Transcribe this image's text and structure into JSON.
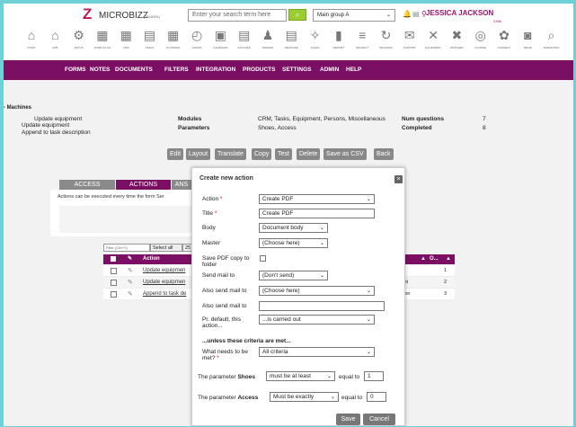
{
  "header": {
    "brand": "MICROBIZZ",
    "version": "(3010921)",
    "search_placeholder": "Enter your search term here",
    "group_select": "Main group A",
    "user_name": "JESSICA JACKSON",
    "user_id": "2396",
    "brand_color": "#7a0f63",
    "toolbar": [
      {
        "label": "Start",
        "icon": "house-icon"
      },
      {
        "label": "ADB",
        "icon": "bank-icon"
      },
      {
        "label": "Setup",
        "icon": "gear-icon"
      },
      {
        "label": "Work Plan",
        "icon": "grid-icon"
      },
      {
        "label": "CRM",
        "icon": "table-icon"
      },
      {
        "label": "Tasks",
        "icon": "list-icon"
      },
      {
        "label": "Planning",
        "icon": "planning-icon"
      },
      {
        "label": "Hours",
        "icon": "clock-icon"
      },
      {
        "label": "Calendar",
        "icon": "calendar-icon"
      },
      {
        "label": "Invoices",
        "icon": "invoice-icon"
      },
      {
        "label": "Person",
        "icon": "person-icon"
      },
      {
        "label": "Register",
        "icon": "register-icon"
      },
      {
        "label": "Sales",
        "icon": "sales-icon"
      },
      {
        "label": "Report",
        "icon": "chart-icon"
      },
      {
        "label": "Project",
        "icon": "project-icon"
      },
      {
        "label": "Process",
        "icon": "process-icon"
      },
      {
        "label": "Support",
        "icon": "support-icon"
      },
      {
        "label": "Equipment",
        "icon": "tools-icon"
      },
      {
        "label": "Intranet",
        "icon": "close-icon"
      },
      {
        "label": "Course",
        "icon": "course-icon"
      },
      {
        "label": "Connect",
        "icon": "connect-icon"
      },
      {
        "label": "Drive",
        "icon": "car-icon"
      },
      {
        "label": "Marketing",
        "icon": "search-icon"
      }
    ]
  },
  "nav": [
    "FORMS",
    "NOTES",
    "DOCUMENTS",
    "FILTERS",
    "INTEGRATION",
    "PRODUCTS",
    "SETTINGS",
    "ADMIN",
    "HELP"
  ],
  "section": "- Machines",
  "info": {
    "left": [
      "Update equipment",
      "Update equipment",
      "Append to task description"
    ],
    "modules_label": "Modules",
    "modules_value": "CRM, Tasks, Equipment, Persons, Miscellaneous",
    "parameters_label": "Parameters",
    "parameters_value": "Shoes, Access",
    "numq_label": "Num questions",
    "numq_value": "7",
    "completed_label": "Completed",
    "completed_value": "8"
  },
  "buttons": [
    "Edit",
    "Layout",
    "Translate",
    "Copy",
    "Test",
    "Delete",
    "Save as CSV",
    "Back"
  ],
  "tabs": [
    "ACCESS",
    "ACTIONS",
    "ANS"
  ],
  "panel_text": "Actions can be executed every time the form Ser",
  "grid": {
    "filter": "Filter (Ctrl+Y)",
    "select_all": "Select all",
    "page_size": "25",
    "col_action": "Action",
    "rows": [
      "Update equipmen",
      "Update equipmen",
      "Append to task de"
    ],
    "right_rows": [
      {
        "text": "",
        "num": "1"
      },
      {
        "text": "intment",
        "num": "2"
      },
      {
        "text": "scription",
        "num": "3"
      }
    ],
    "col_o": "O..."
  },
  "modal": {
    "title": "Create new action",
    "action_label": "Action",
    "action_value": "Create PDF",
    "title_label": "Title",
    "title_value": "Create PDF",
    "body_label": "Body",
    "body_value": "Document body",
    "master_label": "Master",
    "master_value": "(Choose here)",
    "savepdf_label": "Save PDF copy to folder",
    "sendmail_label": "Send mail to",
    "sendmail_value": "(Don't send)",
    "alsosend_label": "Also send mail to",
    "alsosend_value": "(Choose here)",
    "alsosend2_label": "Also send mail to",
    "alsosend2_value": "",
    "default_label": "Pr. default, this action...",
    "default_value": "...is carried out",
    "criteria_heading": "...unless these criteria are met...",
    "needs_label": "What needs to be met?",
    "needs_value": "All criteria",
    "shoes_label_a": "The parameter ",
    "shoes_param": "Shoes",
    "shoes_cond": "must be at least",
    "shoes_eq": "equal to",
    "shoes_val": "1",
    "access_label_a": "The parameter ",
    "access_param": "Access",
    "access_cond": "Must be exactly",
    "access_eq": "equal to",
    "access_val": "0",
    "save": "Save",
    "cancel": "Cancel"
  }
}
